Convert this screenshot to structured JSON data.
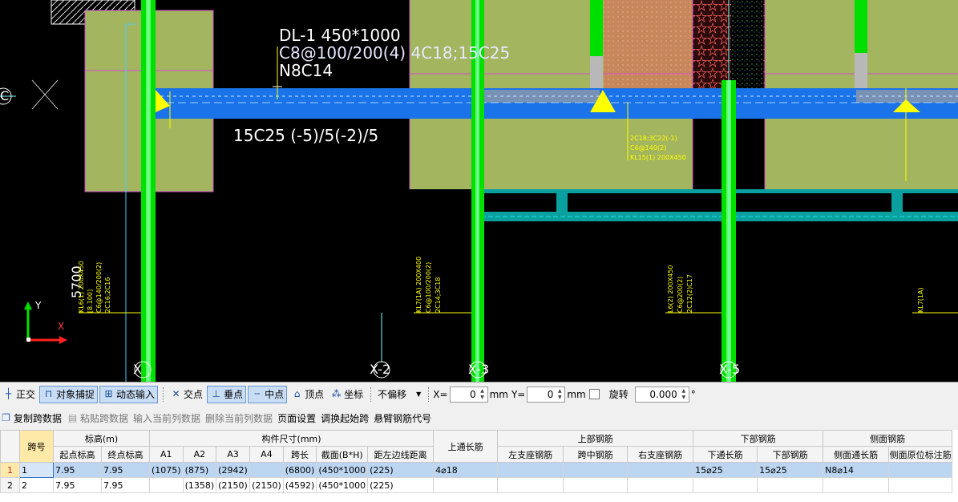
{
  "drawing": {
    "beam_label_line1": "DL-1 450*1000",
    "beam_label_line2": "C8@100/200(4) 4C18;15C25",
    "beam_label_line3": "N8C14",
    "bottom_rebar_label": "15C25 (-5)/5(-2)/5",
    "dimension_5700": "5700",
    "axis_c": "C",
    "axis_x1": "X",
    "axis_x2": "X-2",
    "axis_x3": "X-3",
    "axis_x5": "X-5",
    "ucs_y": "Y",
    "ucs_x": "X",
    "kl15_line1": "2C18;3C22(-1)",
    "kl15_line2": "C6@140(2)",
    "kl15_line3": "KL15(1) 200X450",
    "v_left_1": "KL6(1) 200X450",
    "v_left_2": "[8.100]",
    "v_left_3": "C6@140/200(2)",
    "v_left_4": "2C16;2C16",
    "v_mid_1": "KL7(1A) 200X400",
    "v_mid_2": "C6@100/200(2)",
    "v_mid_3": "2C14;3C18",
    "v_right_1": "L6(2) 200X450",
    "v_right_2": "C6@200(2)",
    "v_right_3": "2C12(2)C17",
    "v_far_1": "KL7(1A)"
  },
  "snapbar": {
    "ortho": "正交",
    "object_snap": "对象捕捉",
    "dynamic_input": "动态输入",
    "intersection": "交点",
    "perpendicular": "垂点",
    "midpoint": "中点",
    "vertex": "顶点",
    "coordinate": "坐标",
    "offset_select": "不偏移",
    "x_label": "X=",
    "x_value": "0",
    "x_unit": "mm",
    "y_label": "Y=",
    "y_value": "0",
    "y_unit": "mm",
    "rotate_label": "旋转",
    "rotate_value": "0.000",
    "rotate_unit": "°"
  },
  "toolbar": {
    "copy_span": "复制跨数据",
    "paste_span": "粘贴跨数据",
    "input_column": "输入当前列数据",
    "delete_column": "删除当前列数据",
    "page_setup": "页面设置",
    "swap_start": "调换起始跨",
    "cantilever_code": "悬臂钢筋代号"
  },
  "table": {
    "h_span": "跨号",
    "h_elevation": "标高(m)",
    "h_start_elev": "起点标高",
    "h_end_elev": "终点标高",
    "h_size": "构件尺寸(mm)",
    "h_a1": "A1",
    "h_a2": "A2",
    "h_a3": "A3",
    "h_a4": "A4",
    "h_span_len": "跨长",
    "h_section": "截面(B*H)",
    "h_edge_dist": "距左边线距离",
    "h_top_through": "上通长筋",
    "h_top_rebar": "上部钢筋",
    "h_left_support": "左支座钢筋",
    "h_mid_span": "跨中钢筋",
    "h_right_support": "右支座钢筋",
    "h_bottom_rebar": "下部钢筋",
    "h_bottom_through": "下通长筋",
    "h_bottom_rebar2": "下部钢筋",
    "h_side_rebar": "侧面钢筋",
    "h_side_through": "侧面通长筋",
    "h_side_mark": "侧面原位标注筋",
    "rows": [
      {
        "rn": "1",
        "span": "1",
        "start": "7.95",
        "end": "7.95",
        "a1": "(1075)",
        "a2": "(875)",
        "a3": "(2942)",
        "a4": "",
        "len": "(6800)",
        "section": "(450*1000",
        "edge": "(225)",
        "top": "4⌀18",
        "left": "",
        "mid": "",
        "right": "",
        "bot_through": "15⌀25",
        "bot": "15⌀25",
        "side_through": "N8⌀14",
        "side_mark": ""
      },
      {
        "rn": "2",
        "span": "2",
        "start": "7.95",
        "end": "7.95",
        "a1": "",
        "a2": "(1358)",
        "a3": "(2150)",
        "a4": "(2150)",
        "len": "(4592)",
        "section": "(450*1000",
        "edge": "(225)",
        "top": "",
        "left": "",
        "mid": "",
        "right": "",
        "bot_through": "",
        "bot": "",
        "side_through": "",
        "side_mark": ""
      }
    ]
  },
  "colors": {
    "cad_bg": "#000000",
    "beam_blue": "#1a73e8",
    "column_green": "#00e000",
    "slab_olive": "#a3b55f",
    "support_yellow": "#ffff00",
    "selected_row": "#bcd6f2"
  }
}
